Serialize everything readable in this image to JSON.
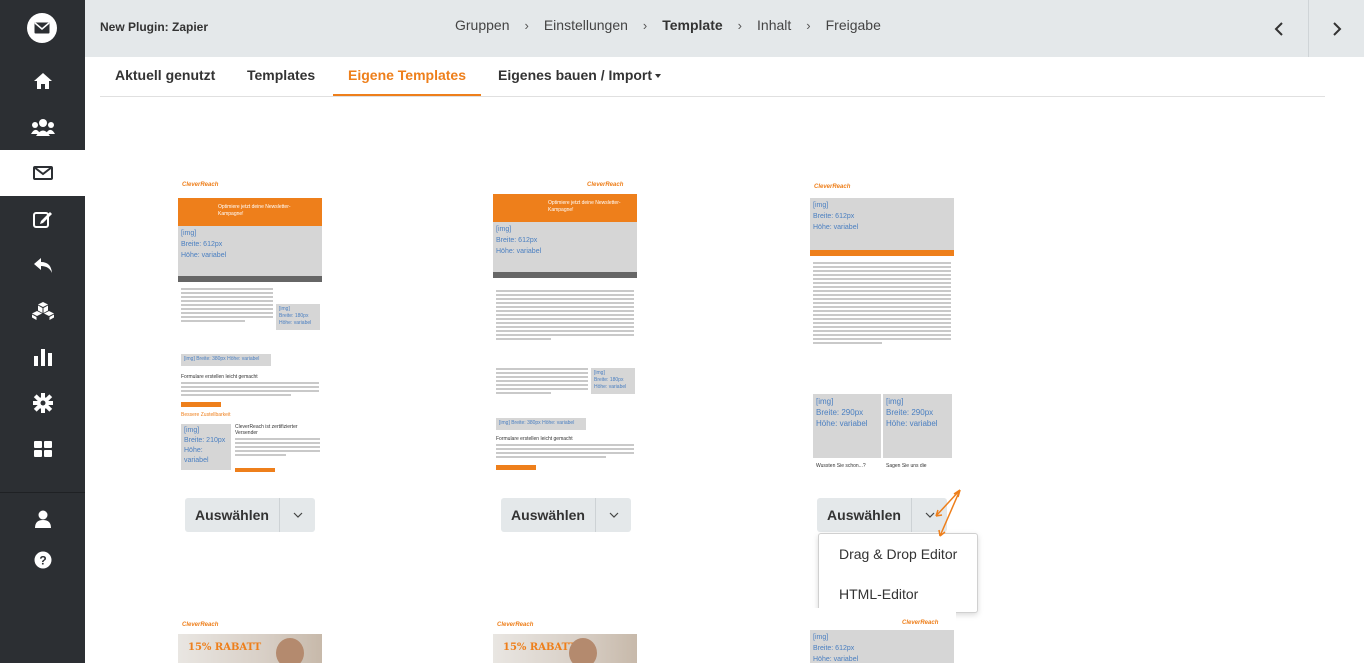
{
  "sidebar": {
    "items": [
      {
        "icon": "home-icon"
      },
      {
        "icon": "users-icon"
      },
      {
        "icon": "mail-icon",
        "active": true
      },
      {
        "icon": "edit-icon"
      },
      {
        "icon": "reply-icon"
      },
      {
        "icon": "cubes-icon"
      },
      {
        "icon": "bar-chart-icon"
      },
      {
        "icon": "gear-icon"
      },
      {
        "icon": "apps-icon"
      },
      {
        "icon": "user-icon"
      },
      {
        "icon": "help-icon"
      }
    ]
  },
  "header": {
    "plugin_title": "New Plugin: Zapier",
    "breadcrumbs": [
      "Gruppen",
      "Einstellungen",
      "Template",
      "Inhalt",
      "Freigabe"
    ],
    "current_step": "Template"
  },
  "tabs": [
    {
      "label": "Aktuell genutzt"
    },
    {
      "label": "Templates"
    },
    {
      "label": "Eigene Templates",
      "active": true
    },
    {
      "label": "Eigenes bauen / Import"
    }
  ],
  "thumbnails": {
    "brand": "CleverReach",
    "banner": "Optimiere jetzt deine Newsletter-Kampagne!",
    "img_main": [
      "[img]",
      "Breite: 612px",
      "Höhe: variabel"
    ],
    "img_small": [
      "[img]",
      "Breite: 180px",
      "Höhe: variabel"
    ],
    "img_wide": [
      "[img] Breite: 380px",
      "Höhe: variabel"
    ],
    "img_half": [
      "[img]",
      "Breite: 290px",
      "Höhe: variabel"
    ],
    "img_210": [
      "[img]",
      "Breite: 210px",
      "Höhe: variabel"
    ],
    "heading_forms": "Formulare erstellen leicht gemacht",
    "heading_basket": "Bessere Zustellbarkeit",
    "heading_cert": "CleverReach ist zertifizierter Versender",
    "wussten": "Wussten Sie schon...?",
    "sagen": "Sagen Sie uns die",
    "rabatt": "15% RABATT"
  },
  "cards": [
    {
      "select_label": "Auswählen"
    },
    {
      "select_label": "Auswählen"
    },
    {
      "select_label": "Auswählen"
    }
  ],
  "dropdown": {
    "items": [
      "Drag & Drop Editor",
      "HTML-Editor"
    ]
  },
  "colors": {
    "accent": "#ee7f1b",
    "sidebar_bg": "#2c2f33",
    "topbar_bg": "#e4e8ea"
  }
}
